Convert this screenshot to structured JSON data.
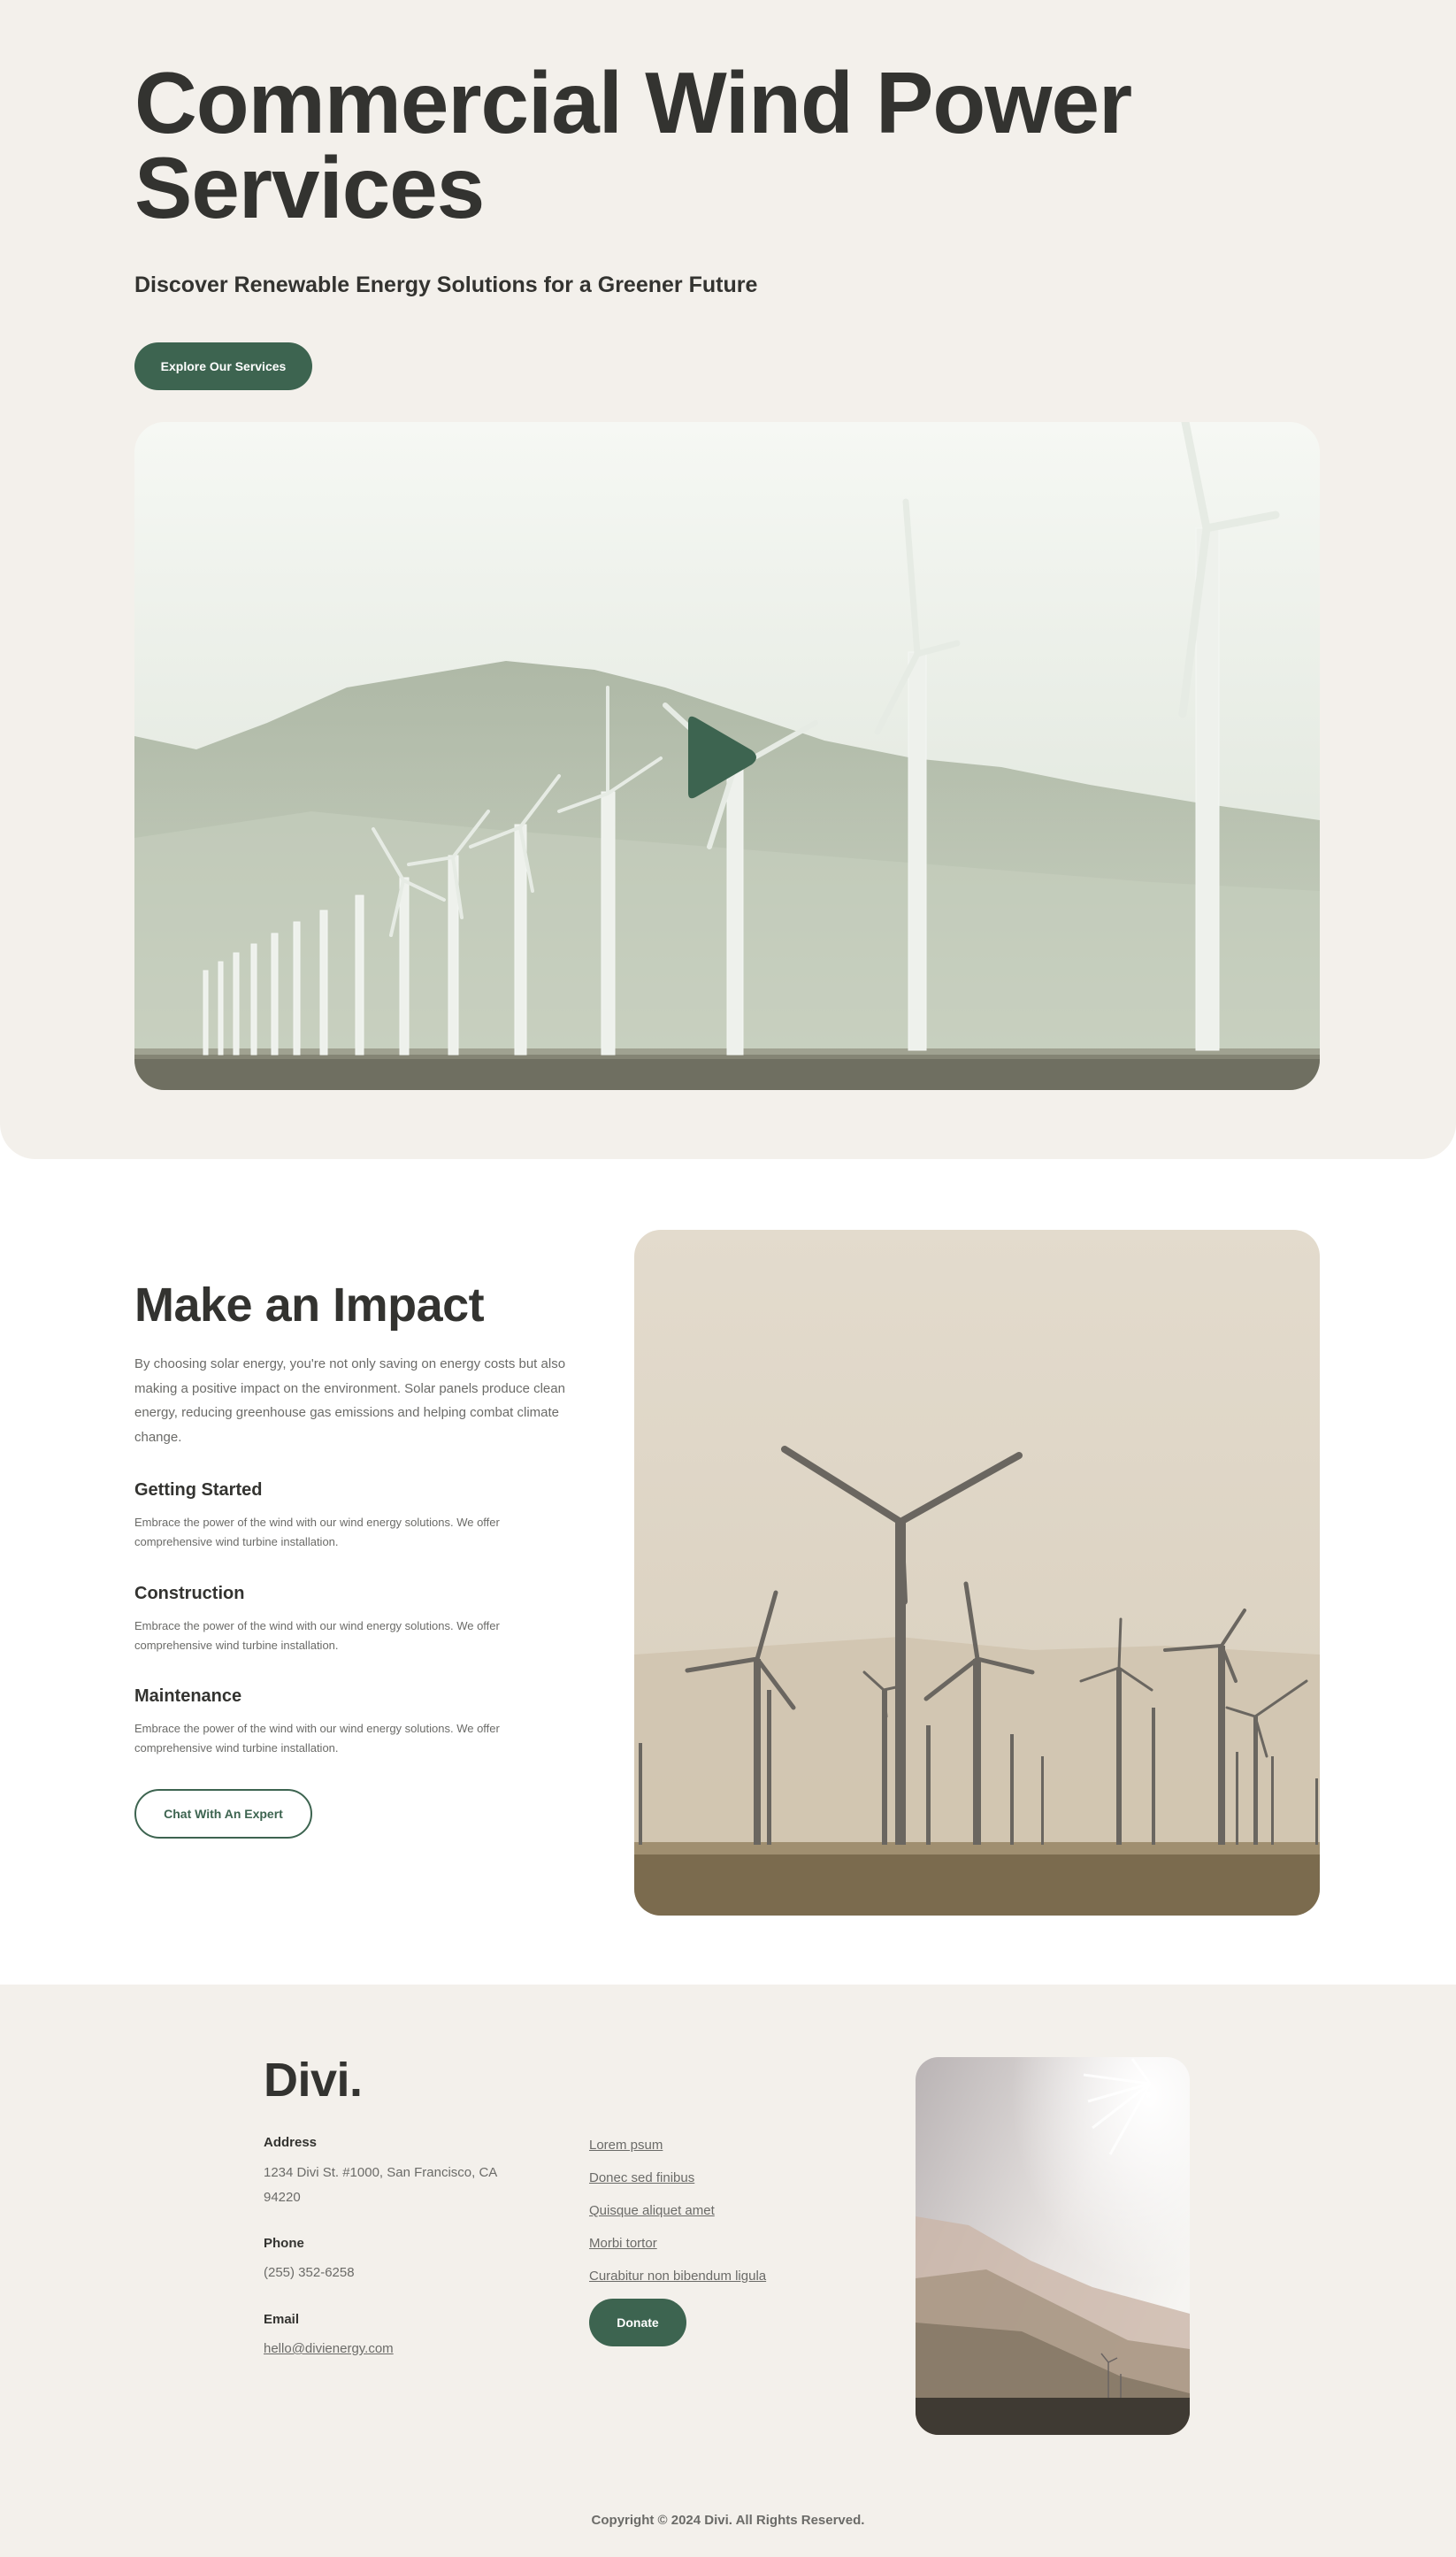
{
  "hero": {
    "title": "Commercial Wind Power Services",
    "subtitle": "Discover Renewable Energy Solutions for a Greener Future",
    "cta_label": "Explore Our Services"
  },
  "impact": {
    "title": "Make an Impact",
    "body": "By choosing solar energy, you're not only saving on energy costs but also making a positive impact on the environment. Solar panels produce clean energy, reducing greenhouse gas emissions and helping combat climate change.",
    "features": [
      {
        "title": "Getting Started",
        "text": "Embrace the power of the wind with our wind energy solutions. We offer comprehensive wind turbine installation."
      },
      {
        "title": "Construction",
        "text": "Embrace the power of the wind with our wind energy solutions. We offer comprehensive wind turbine installation."
      },
      {
        "title": "Maintenance",
        "text": "Embrace the power of the wind with our wind energy solutions. We offer comprehensive wind turbine installation."
      }
    ],
    "cta_label": "Chat With An Expert"
  },
  "footer": {
    "logo": "Divi.",
    "address_label": "Address",
    "address": "1234 Divi St. #1000, San Francisco, CA 94220",
    "phone_label": "Phone",
    "phone": "(255) 352-6258",
    "email_label": "Email",
    "email": "hello@divienergy.com",
    "links": [
      "Lorem psum",
      "Donec sed finibus",
      "Quisque aliquet amet",
      "Morbi tortor",
      "Curabitur non bibendum ligula"
    ],
    "donate_label": "Donate",
    "copyright": "Copyright © 2024 Divi. All Rights Reserved."
  },
  "colors": {
    "accent": "#3d6450",
    "page_bg": "#f3f0eb",
    "heading": "#333330",
    "body_text": "#6b6b68"
  },
  "icons": {
    "video_play": "play-icon"
  }
}
